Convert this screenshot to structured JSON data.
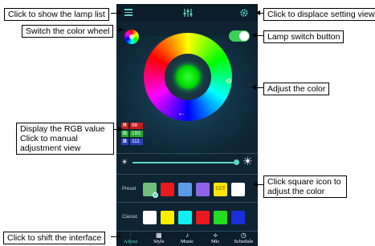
{
  "callouts": {
    "lamp_list": "Click to show the lamp list",
    "color_wheel": "Switch the color wheel",
    "rgb_line1": "Display the RGB value",
    "rgb_line2": "Click to manual",
    "rgb_line3": "adjustment view",
    "shift_interface": "Click to shift the interface",
    "setting_view": "Click to displace setting view",
    "lamp_switch": "Lamp switch button",
    "adjust_color": "Adjust the color",
    "square_line1": "Click square icon to",
    "square_line2": "adjust the color"
  },
  "app": {
    "top_icons": [
      "list-icon",
      "sliders-icon",
      "gear-icon"
    ],
    "lamp_on": true,
    "selected_color": "#00ff33",
    "rgb": {
      "r_label": "R",
      "r_value": "98",
      "g_label": "G",
      "g_value": "193",
      "b_label": "B",
      "b_value": "111"
    },
    "brightness_percent": 100,
    "preset": {
      "label": "Preset",
      "swatches": [
        {
          "color": "#6fbf7a",
          "text": "",
          "selected": true
        },
        {
          "color": "#e8191f",
          "text": ""
        },
        {
          "color": "#5b9ce6",
          "text": ""
        },
        {
          "color": "#8f63e8",
          "text": ""
        },
        {
          "color": "#ffe600",
          "text": "CCT"
        },
        {
          "color": "#ffffff",
          "text": ""
        }
      ]
    },
    "classic": {
      "label": "Classic",
      "swatches": [
        {
          "color": "#ffffff"
        },
        {
          "color": "#ffee00"
        },
        {
          "color": "#11f0f0"
        },
        {
          "color": "#e8191f"
        },
        {
          "color": "#22dd22"
        },
        {
          "color": "#1a2fd8"
        }
      ]
    },
    "tabs": [
      {
        "label": "Adjust",
        "icon": "sliders-icon",
        "active": true
      },
      {
        "label": "Style",
        "icon": "grid-icon"
      },
      {
        "label": "Music",
        "icon": "music-note-icon"
      },
      {
        "label": "Mic",
        "icon": "microphone-icon"
      },
      {
        "label": "Schedule",
        "icon": "clock-icon"
      }
    ],
    "tab_glyphs": [
      "⫶",
      "▦",
      "♪",
      "⟡",
      "◷"
    ]
  }
}
